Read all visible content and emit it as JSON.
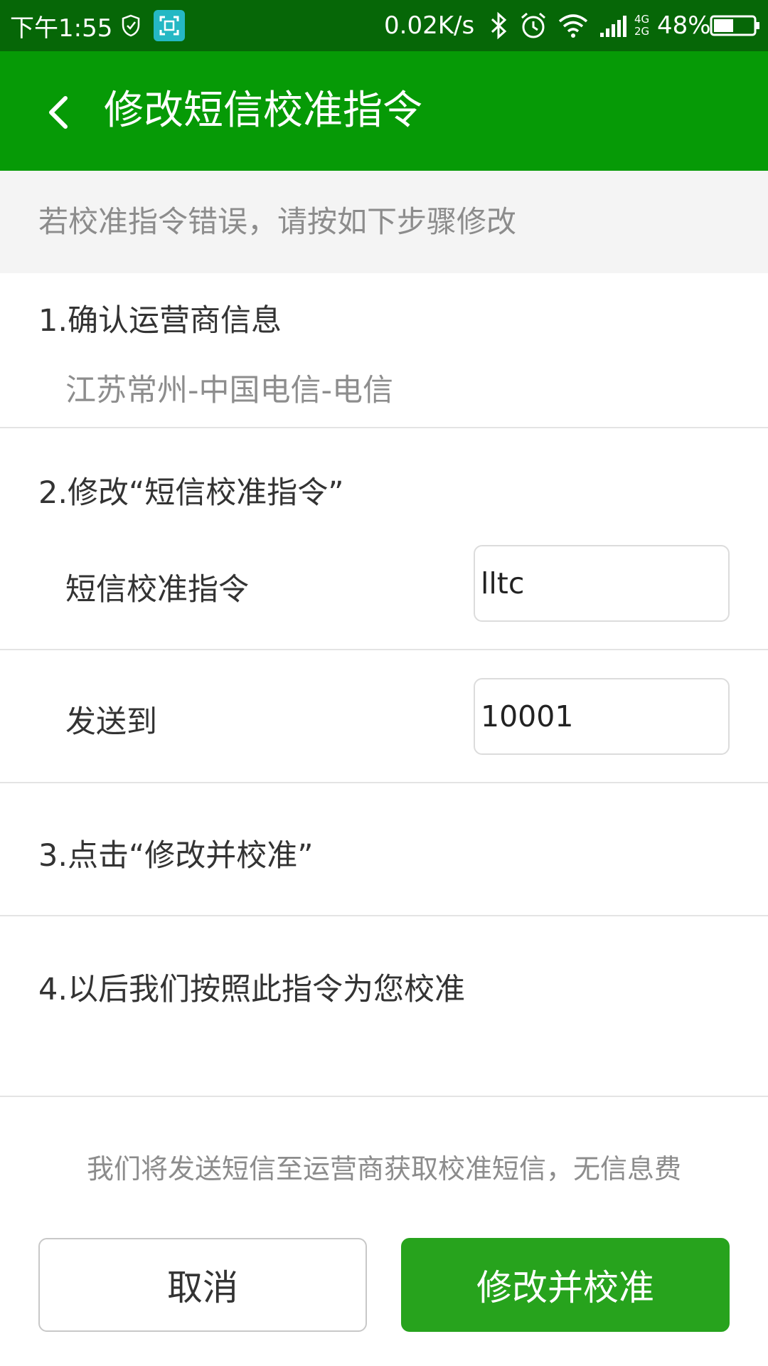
{
  "status_bar": {
    "time": "下午1:55",
    "net_speed": "0.02K/s",
    "network_type_top": "4G",
    "network_type_bottom": "2G",
    "battery": "48%",
    "background_color": "#066707"
  },
  "app_bar": {
    "title": "修改短信校准指令",
    "background_color": "#069a06"
  },
  "hint": "若校准指令错误，请按如下步骤修改",
  "step1": {
    "title": "1.确认运营商信息",
    "carrier_info": "江苏常州-中国电信-电信"
  },
  "step2": {
    "title": "2.修改“短信校准指令”",
    "command_label": "短信校准指令",
    "command_value": "lltc",
    "send_to_label": "发送到",
    "send_to_value": "10001"
  },
  "step3": {
    "title": "3.点击“修改并校准”"
  },
  "step4": {
    "title": "4.以后我们按照此指令为您校准"
  },
  "notice": "我们将发送短信至运营商获取校准短信，无信息费",
  "buttons": {
    "cancel": "取消",
    "confirm": "修改并校准",
    "confirm_color": "#27a31d"
  },
  "icons": [
    "shield-icon",
    "scan-icon",
    "bluetooth-icon",
    "alarm-icon",
    "wifi-icon",
    "signal-icon",
    "battery-icon",
    "back-arrow-icon"
  ]
}
